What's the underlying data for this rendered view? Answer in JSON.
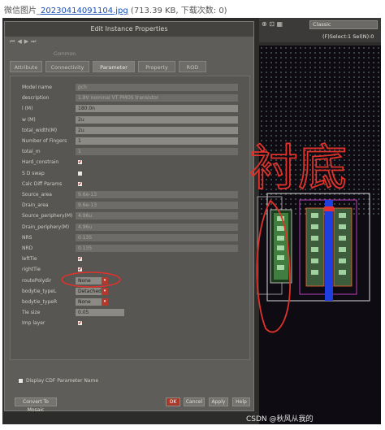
{
  "caption": {
    "prefix": "微信图片_",
    "filename": "20230414091104.jpg",
    "meta": "(713.39 KB, 下载次数: 0)"
  },
  "dialog": {
    "title": "Edit Instance Properties",
    "subtitle": "Common",
    "tabs": [
      "Attribute",
      "Connectivity",
      "Parameter",
      "Property",
      "ROD"
    ],
    "active_tab": "Parameter",
    "rows": [
      {
        "label": "Model name",
        "value": "pch",
        "kind": "dim"
      },
      {
        "label": "description",
        "value": "1.8V nominal VT PMOS transistor",
        "kind": "dim"
      },
      {
        "label": "l (M)",
        "value": "180.0n",
        "kind": "text"
      },
      {
        "label": "w (M)",
        "value": "2u",
        "kind": "text"
      },
      {
        "label": "total_width(M)",
        "value": "2u",
        "kind": "text"
      },
      {
        "label": "Number of Fingers",
        "value": "1",
        "kind": "text"
      },
      {
        "label": "total_m",
        "value": "1",
        "kind": "dim"
      },
      {
        "label": "Hard_constrain",
        "value": "✔",
        "kind": "check"
      },
      {
        "label": "S D swap",
        "value": "",
        "kind": "check"
      },
      {
        "label": "Calc Diff Params",
        "value": "✔",
        "kind": "check"
      },
      {
        "label": "Source_area",
        "value": "9.6e-13",
        "kind": "dim"
      },
      {
        "label": "Drain_area",
        "value": "9.6e-13",
        "kind": "dim"
      },
      {
        "label": "Source_periphery(M)",
        "value": "4.96u",
        "kind": "dim"
      },
      {
        "label": "Drain_periphery(M)",
        "value": "4.96u",
        "kind": "dim"
      },
      {
        "label": "NRS",
        "value": "0.135",
        "kind": "dim"
      },
      {
        "label": "NRD",
        "value": "0.135",
        "kind": "dim"
      },
      {
        "label": "leftTie",
        "value": "✔",
        "kind": "check"
      },
      {
        "label": "rightTie",
        "value": "✔",
        "kind": "check"
      },
      {
        "label": "routePolydir",
        "value": "None",
        "kind": "combo"
      },
      {
        "label": "bodytie_typeL",
        "value": "Detached",
        "kind": "combo"
      },
      {
        "label": "bodytie_typeR",
        "value": "None",
        "kind": "combo"
      },
      {
        "label": "Tie size",
        "value": "0.05",
        "kind": "short"
      },
      {
        "label": "Imp layer",
        "value": "✔",
        "kind": "check"
      }
    ],
    "display_cdf": "Display CDF Parameter Name",
    "buttons": {
      "ok": "OK",
      "cancel": "Cancel",
      "apply": "Apply",
      "help": "Help",
      "convert": "Convert To Mosaic"
    }
  },
  "layout": {
    "view_mode": "Classic",
    "select_text": "(F)Select:1  Sel(N):0",
    "handwritten": "衬底"
  },
  "watermark": "CSDN @秋风从我的"
}
